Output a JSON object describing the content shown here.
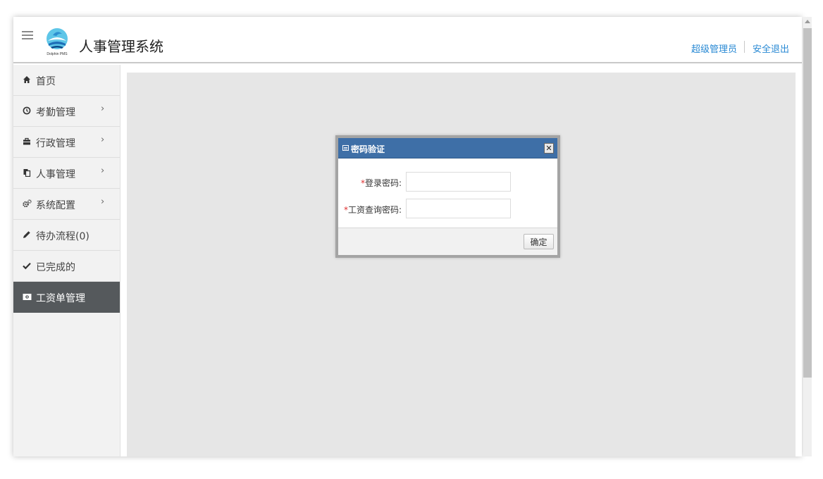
{
  "header": {
    "app_title": "人事管理系统",
    "logo_text": "Dolphin PMS",
    "user_label": "超级管理员",
    "logout_label": "安全退出"
  },
  "sidebar": {
    "items": [
      {
        "icon": "home-icon",
        "label": "首页",
        "has_submenu": false
      },
      {
        "icon": "clock-icon",
        "label": "考勤管理",
        "has_submenu": true
      },
      {
        "icon": "briefcase-icon",
        "label": "行政管理",
        "has_submenu": true
      },
      {
        "icon": "copy-icon",
        "label": "人事管理",
        "has_submenu": true
      },
      {
        "icon": "gears-icon",
        "label": "系统配置",
        "has_submenu": true
      },
      {
        "icon": "pencil-icon",
        "label": "待办流程(0)",
        "has_submenu": false
      },
      {
        "icon": "check-icon",
        "label": "已完成的",
        "has_submenu": false
      },
      {
        "icon": "money-icon",
        "label": "工资单管理",
        "has_submenu": false,
        "active": true
      }
    ],
    "chevron": "›"
  },
  "modal": {
    "title": "密码验证",
    "close_label": "✕",
    "fields": [
      {
        "label": "登录密码:",
        "required_mark": "*",
        "value": ""
      },
      {
        "label": "工资查询密码:",
        "required_mark": "*",
        "value": ""
      }
    ],
    "confirm_label": "确定"
  },
  "colors": {
    "accent_link": "#2a8ad4",
    "modal_header": "#3e6fa7",
    "sidebar_active": "#55595c",
    "content_bg": "#e6e6e6"
  }
}
